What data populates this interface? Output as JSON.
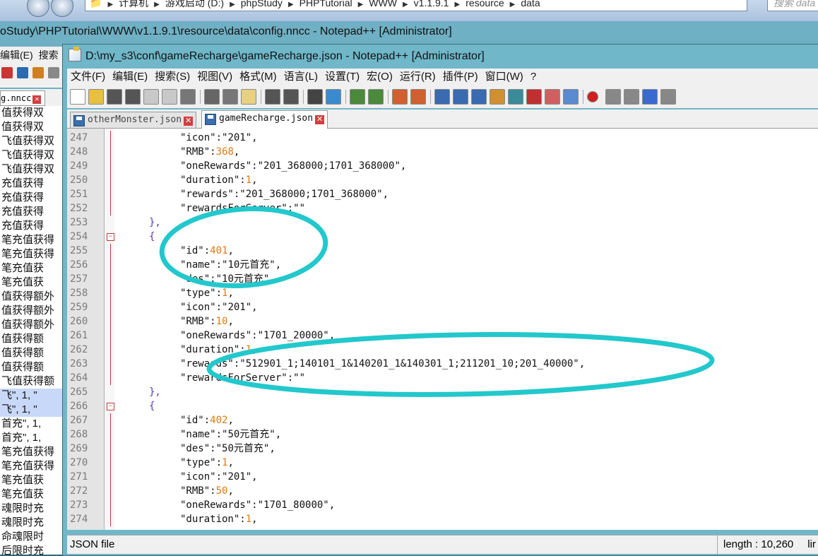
{
  "explorer": {
    "path_parts": [
      "计算机",
      "游戏启动 (D:)",
      "phpStudy",
      "PHPTutorial",
      "WWW",
      "v1.1.9.1",
      "resource",
      "data"
    ],
    "search_placeholder": "搜索 data"
  },
  "back_window": {
    "title": "oStudy\\PHPTutorial\\WWW\\v1.1.9.1\\resource\\data\\config.nncc - Notepad++ [Administrator]",
    "menu": [
      "编辑(E)",
      "搜索"
    ],
    "tab_label": "g.nncc",
    "lines": [
      "值获得双",
      "值获得双",
      "飞值获得双",
      "飞值获得双",
      "飞值获得双",
      "充值获得",
      "充值获得",
      "充值获得",
      "充值获得",
      "笔充值获得",
      "笔充值获得",
      "笔充值获",
      "笔充值获",
      "值获得额外",
      "值获得额外",
      "值获得额外",
      "值获得额",
      "值获得额",
      "值获得额",
      "飞值获得额",
      "飞\", 1, \"",
      "飞\", 1, \"",
      "首充\", 1,",
      "首充\", 1,",
      "笔充值获得",
      "笔充值获得",
      "笔充值获",
      "笔充值获",
      "魂限时充",
      "魂限时充",
      "命魂限时",
      "后限时充"
    ]
  },
  "main_window": {
    "title": "D:\\my_s3\\conf\\gameRecharge\\gameRecharge.json - Notepad++ [Administrator]",
    "menu": [
      "文件(F)",
      "编辑(E)",
      "搜索(S)",
      "视图(V)",
      "格式(M)",
      "语言(L)",
      "设置(T)",
      "宏(O)",
      "运行(R)",
      "插件(P)",
      "窗口(W)",
      "?"
    ],
    "tabs": [
      {
        "label": "otherMonster.json",
        "active": false
      },
      {
        "label": "gameRecharge.json",
        "active": true
      }
    ],
    "code_lines": [
      {
        "n": "247",
        "indent": 8,
        "key": "\"icon\"",
        "val": "\"201\"",
        "kind": "str",
        "tail": ","
      },
      {
        "n": "248",
        "indent": 8,
        "key": "\"RMB\"",
        "val": "368",
        "kind": "num",
        "tail": ","
      },
      {
        "n": "249",
        "indent": 8,
        "key": "\"oneRewards\"",
        "val": "\"201_368000;1701_368000\"",
        "kind": "str",
        "tail": ","
      },
      {
        "n": "250",
        "indent": 8,
        "key": "\"duration\"",
        "val": "1",
        "kind": "num",
        "tail": ","
      },
      {
        "n": "251",
        "indent": 8,
        "key": "\"rewards\"",
        "val": "\"201_368000;1701_368000\"",
        "kind": "str",
        "tail": ","
      },
      {
        "n": "252",
        "indent": 8,
        "key": "\"rewardsForServer\"",
        "val": "\"\"",
        "kind": "str",
        "tail": ""
      },
      {
        "n": "253",
        "indent": 4,
        "brace": "},"
      },
      {
        "n": "254",
        "indent": 4,
        "brace": "{"
      },
      {
        "n": "255",
        "indent": 8,
        "key": "\"id\"",
        "val": "401",
        "kind": "num",
        "tail": ","
      },
      {
        "n": "256",
        "indent": 8,
        "key": "\"name\"",
        "val": "\"10元首充\"",
        "kind": "str",
        "tail": ","
      },
      {
        "n": "257",
        "indent": 8,
        "key": "\"des\"",
        "val": "\"10元首充\"",
        "kind": "str",
        "tail": ","
      },
      {
        "n": "258",
        "indent": 8,
        "key": "\"type\"",
        "val": "1",
        "kind": "num",
        "tail": ","
      },
      {
        "n": "259",
        "indent": 8,
        "key": "\"icon\"",
        "val": "\"201\"",
        "kind": "str",
        "tail": ","
      },
      {
        "n": "260",
        "indent": 8,
        "key": "\"RMB\"",
        "val": "10",
        "kind": "num",
        "tail": ","
      },
      {
        "n": "261",
        "indent": 8,
        "key": "\"oneRewards\"",
        "val": "\"1701_20000\"",
        "kind": "str",
        "tail": ","
      },
      {
        "n": "262",
        "indent": 8,
        "key": "\"duration\"",
        "val": "1",
        "kind": "num",
        "tail": ","
      },
      {
        "n": "263",
        "indent": 8,
        "key": "\"rewards\"",
        "val": "\"512901_1;140101_1&140201_1&140301_1;211201_10;201_40000\"",
        "kind": "str",
        "tail": ","
      },
      {
        "n": "264",
        "indent": 8,
        "key": "\"rewardsForServer\"",
        "val": "\"\"",
        "kind": "str",
        "tail": ""
      },
      {
        "n": "265",
        "indent": 4,
        "brace": "},"
      },
      {
        "n": "266",
        "indent": 4,
        "brace": "{"
      },
      {
        "n": "267",
        "indent": 8,
        "key": "\"id\"",
        "val": "402",
        "kind": "num",
        "tail": ","
      },
      {
        "n": "268",
        "indent": 8,
        "key": "\"name\"",
        "val": "\"50元首充\"",
        "kind": "str",
        "tail": ","
      },
      {
        "n": "269",
        "indent": 8,
        "key": "\"des\"",
        "val": "\"50元首充\"",
        "kind": "str",
        "tail": ","
      },
      {
        "n": "270",
        "indent": 8,
        "key": "\"type\"",
        "val": "1",
        "kind": "num",
        "tail": ","
      },
      {
        "n": "271",
        "indent": 8,
        "key": "\"icon\"",
        "val": "\"201\"",
        "kind": "str",
        "tail": ","
      },
      {
        "n": "272",
        "indent": 8,
        "key": "\"RMB\"",
        "val": "50",
        "kind": "num",
        "tail": ","
      },
      {
        "n": "273",
        "indent": 8,
        "key": "\"oneRewards\"",
        "val": "\"1701_80000\"",
        "kind": "str",
        "tail": ","
      },
      {
        "n": "274",
        "indent": 8,
        "key": "\"duration\"",
        "val": "1",
        "kind": "num",
        "tail": ","
      }
    ],
    "status": {
      "file_type": "JSON file",
      "length": "length : 10,260",
      "lines_prefix": "lir"
    }
  },
  "colors": {
    "annotation": "#22c8cc",
    "number": "#e07a10",
    "brace": "#5a3ab0",
    "fold": "#c23a3a"
  }
}
